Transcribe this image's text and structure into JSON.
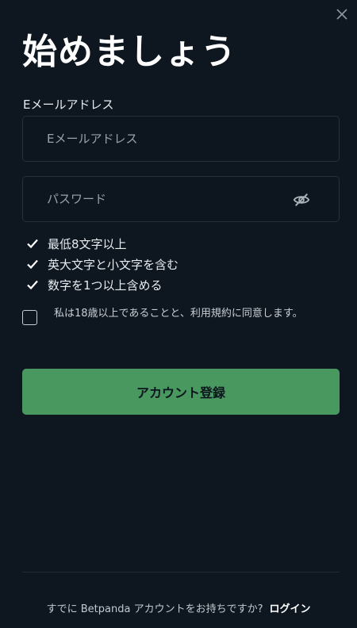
{
  "header": {
    "title": "始めましょう",
    "close_icon": "close-icon"
  },
  "email": {
    "label": "Eメールアドレス",
    "placeholder": "Eメールアドレス",
    "value": ""
  },
  "password": {
    "placeholder": "パスワード",
    "value": "",
    "toggle_icon": "eye-off-icon"
  },
  "rules": [
    {
      "text": "最低8文字以上"
    },
    {
      "text": "英大文字と小文字を含む"
    },
    {
      "text": "数字を1つ以上含める"
    }
  ],
  "terms": {
    "text": "私は18歳以上であることと、利用規約に同意します。",
    "checked": false
  },
  "submit": {
    "label": "アカウント登録"
  },
  "footer": {
    "prompt": "すでに Betpanda アカウントをお持ちですか?",
    "login_label": "ログイン"
  },
  "colors": {
    "background": "#0e1620",
    "accent": "#49985f",
    "border": "#25303b"
  }
}
